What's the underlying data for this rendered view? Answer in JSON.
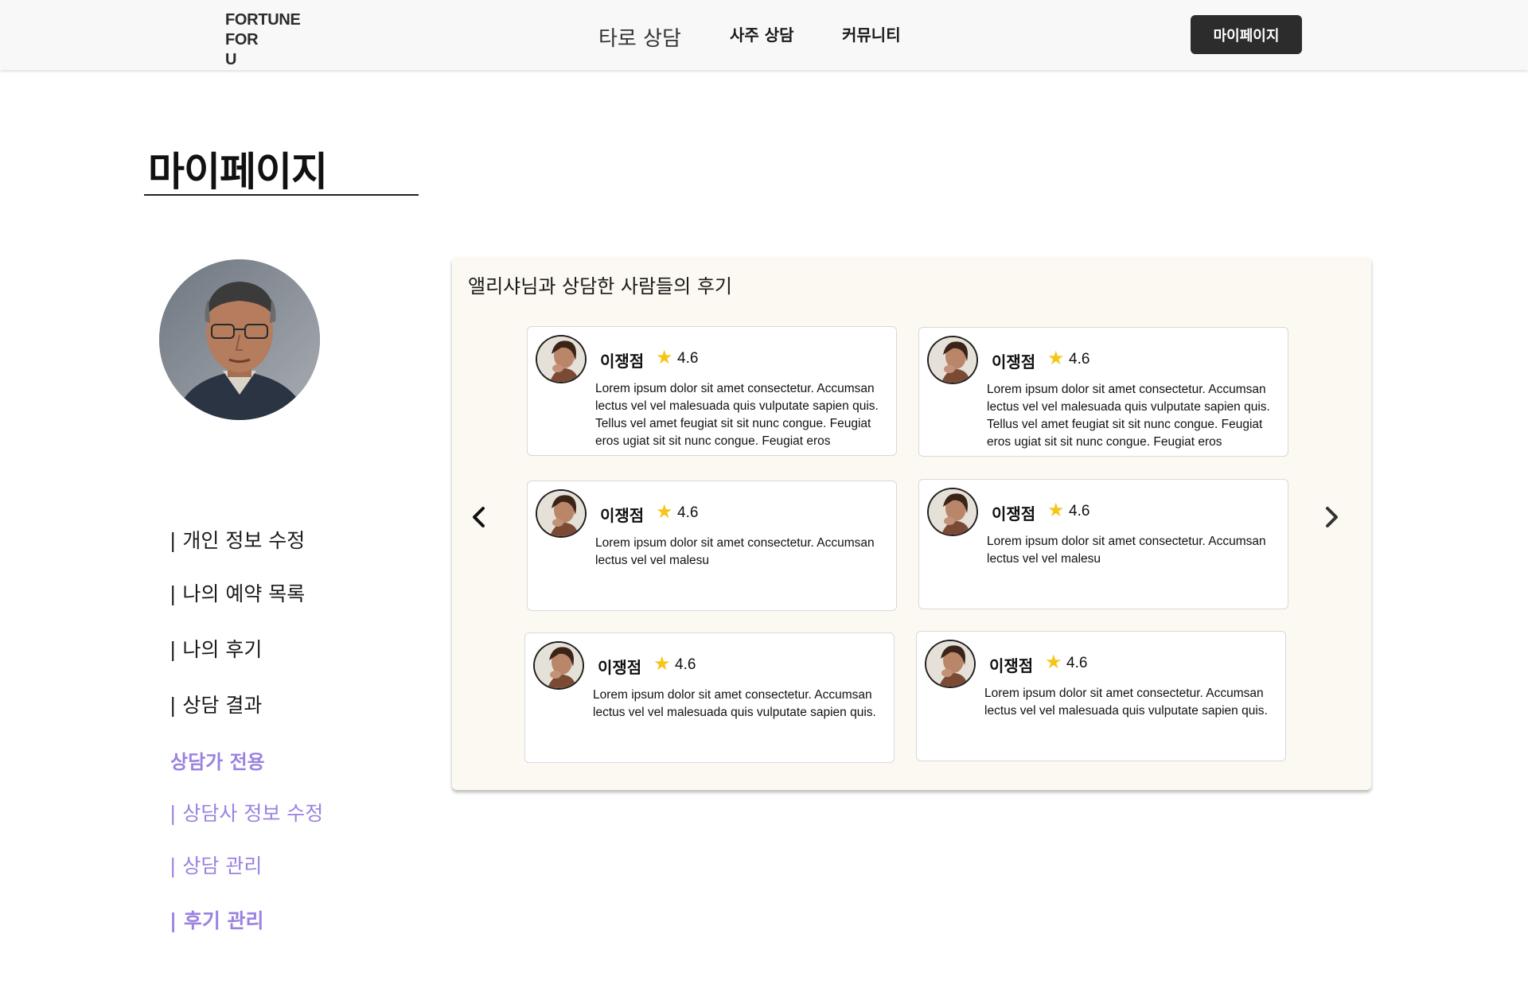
{
  "header": {
    "logo_lines": [
      "FORTUNE",
      "FOR",
      "U"
    ],
    "nav": [
      "타로 상담",
      "사주 상담",
      "커뮤니티"
    ],
    "mypage_button": "마이페이지"
  },
  "page_title": "마이페이지",
  "sidebar": {
    "menu": [
      "| 개인 정보 수정",
      "| 나의 예약 목록",
      "| 나의 후기",
      "| 상담 결과"
    ],
    "counselor_heading": "상담가 전용",
    "counselor_menu": [
      "| 상담사 정보 수정",
      "| 상담 관리",
      "| 후기 관리"
    ]
  },
  "reviews_panel": {
    "title": "앨리샤님과 상담한 사람들의 후기",
    "reviews": [
      {
        "name": "이쟁점",
        "star": "★",
        "rating": "4.6",
        "text": "Lorem ipsum dolor sit amet consectetur. Accumsan lectus vel vel malesuada quis vulputate sapien quis. Tellus vel amet feugiat sit sit nunc congue. Feugiat eros ugiat sit sit nunc congue. Feugiat eros"
      },
      {
        "name": "이쟁점",
        "star": "★",
        "rating": "4.6",
        "text": "Lorem ipsum dolor sit amet consectetur. Accumsan lectus vel vel malesuada quis vulputate sapien quis. Tellus vel amet feugiat sit sit nunc congue. Feugiat eros ugiat sit sit nunc congue. Feugiat eros"
      },
      {
        "name": "이쟁점",
        "star": "★",
        "rating": "4.6",
        "text": "Lorem ipsum dolor sit amet consectetur. Accumsan lectus vel vel malesu"
      },
      {
        "name": "이쟁점",
        "star": "★",
        "rating": "4.6",
        "text": "Lorem ipsum dolor sit amet consectetur. Accumsan lectus vel vel malesu"
      },
      {
        "name": "이쟁점",
        "star": "★",
        "rating": "4.6",
        "text": "Lorem ipsum dolor sit amet consectetur. Accumsan lectus vel vel malesuada quis vulputate sapien quis."
      },
      {
        "name": "이쟁점",
        "star": "★",
        "rating": "4.6",
        "text": "Lorem ipsum dolor sit amet consectetur. Accumsan lectus vel vel malesuada quis vulputate sapien quis."
      }
    ]
  },
  "icons": {
    "prev": "chevron-left-icon",
    "next": "chevron-right-icon",
    "star": "star-icon"
  },
  "colors": {
    "accent_purple": "#9b82e0",
    "star_yellow": "#f5c518",
    "panel_bg": "#fcf9f2",
    "button_dark": "#2c2c2c"
  }
}
